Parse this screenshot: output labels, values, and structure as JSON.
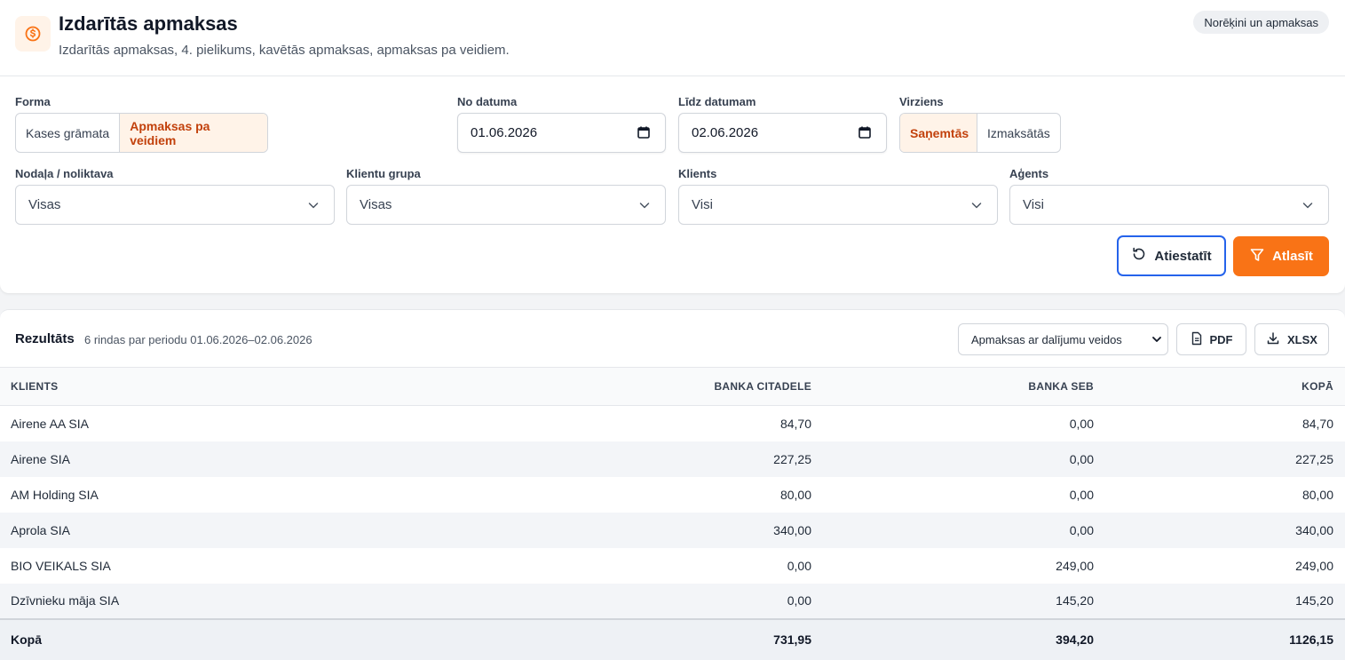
{
  "header": {
    "title": "Izdarītās apmaksas",
    "subtitle": "Izdarītās apmaksas, 4. pielikums, kavētās apmaksas, apmaksas pa veidiem.",
    "badge": "Norēķini un apmaksas",
    "icon": "dollar-circle-icon"
  },
  "filters": {
    "forma": {
      "label": "Forma",
      "options": [
        "Kases grāmata",
        "Apmaksas pa veidiem"
      ],
      "selected": "Apmaksas pa veidiem"
    },
    "no_datuma": {
      "label": "No datuma",
      "value": "01.06.2026"
    },
    "lidz_datumam": {
      "label": "Līdz datumam",
      "value": "02.06.2026"
    },
    "virziens": {
      "label": "Virziens",
      "options": [
        "Saņemtās",
        "Izmaksātās"
      ],
      "selected": "Saņemtās"
    },
    "nodala": {
      "label": "Nodaļa / noliktava",
      "value": "Visas"
    },
    "klientu_grupa": {
      "label": "Klientu grupa",
      "value": "Visas"
    },
    "klients": {
      "label": "Klients",
      "value": "Visi"
    },
    "agents": {
      "label": "Aģents",
      "value": "Visi"
    },
    "reset_label": "Atiestatīt",
    "apply_label": "Atlasīt"
  },
  "results": {
    "title": "Rezultāts",
    "meta": "6 rindas par periodu 01.06.2026–02.06.2026",
    "view_select": "Apmaksas ar dalījumu veidos",
    "pdf_label": "PDF",
    "xlsx_label": "XLSX",
    "columns": [
      "KLIENTS",
      "BANKA CITADELE",
      "BANKA SEB",
      "KOPĀ"
    ],
    "rows": [
      [
        "Airene AA SIA",
        "84,70",
        "0,00",
        "84,70"
      ],
      [
        "Airene SIA",
        "227,25",
        "0,00",
        "227,25"
      ],
      [
        "AM Holding SIA",
        "80,00",
        "0,00",
        "80,00"
      ],
      [
        "Aprola SIA",
        "340,00",
        "0,00",
        "340,00"
      ],
      [
        "BIO VEIKALS SIA",
        "0,00",
        "249,00",
        "249,00"
      ],
      [
        "Dzīvnieku māja SIA",
        "0,00",
        "145,20",
        "145,20"
      ]
    ],
    "total": [
      "Kopā",
      "731,95",
      "394,20",
      "1126,15"
    ]
  },
  "colors": {
    "accent": "#f97316",
    "accent_light": "#fff3e8",
    "focus": "#2563eb"
  }
}
